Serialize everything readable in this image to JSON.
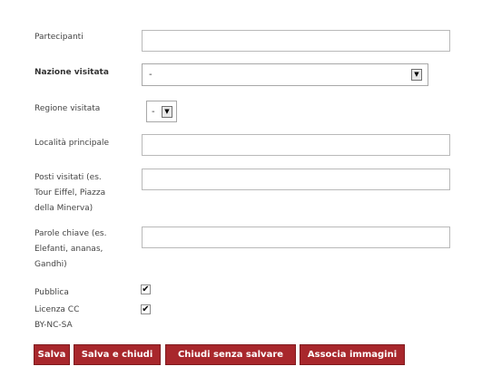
{
  "form": {
    "partecipanti": {
      "label": "Partecipanti",
      "value": ""
    },
    "nazione_visitata": {
      "label": "Nazione visitata",
      "selected": "-",
      "arrow_icon": "dropdown-arrow-icon"
    },
    "regione_visitata": {
      "label": "Regione visitata",
      "selected": "-",
      "arrow_icon": "dropdown-arrow-icon"
    },
    "localita_principale": {
      "label": "Località principale",
      "value": ""
    },
    "posti_visitati": {
      "label_lines": [
        "Posti visitati (es.",
        "Tour Eiffel, Piazza",
        "della Minerva)"
      ],
      "value": ""
    },
    "parole_chiave": {
      "label_lines": [
        "Parole chiave (es.",
        "Elefanti, ananas,",
        "Gandhi)"
      ],
      "value": ""
    },
    "pubblica": {
      "label": "Pubblica",
      "checked": true,
      "check_mark": "✔"
    },
    "licenza_cc": {
      "label_lines": [
        "Licenza CC",
        "BY-NC-SA"
      ],
      "checked": true,
      "check_mark": "✔"
    }
  },
  "buttons": {
    "salva": "Salva",
    "salva_e_chiudi": "Salva e chiudi",
    "chiudi_senza_salvare": "Chiudi senza salvare",
    "associa_immagini": "Associa immagini"
  },
  "colors": {
    "button_bg": "#a8272c",
    "button_text": "#ffffff"
  }
}
